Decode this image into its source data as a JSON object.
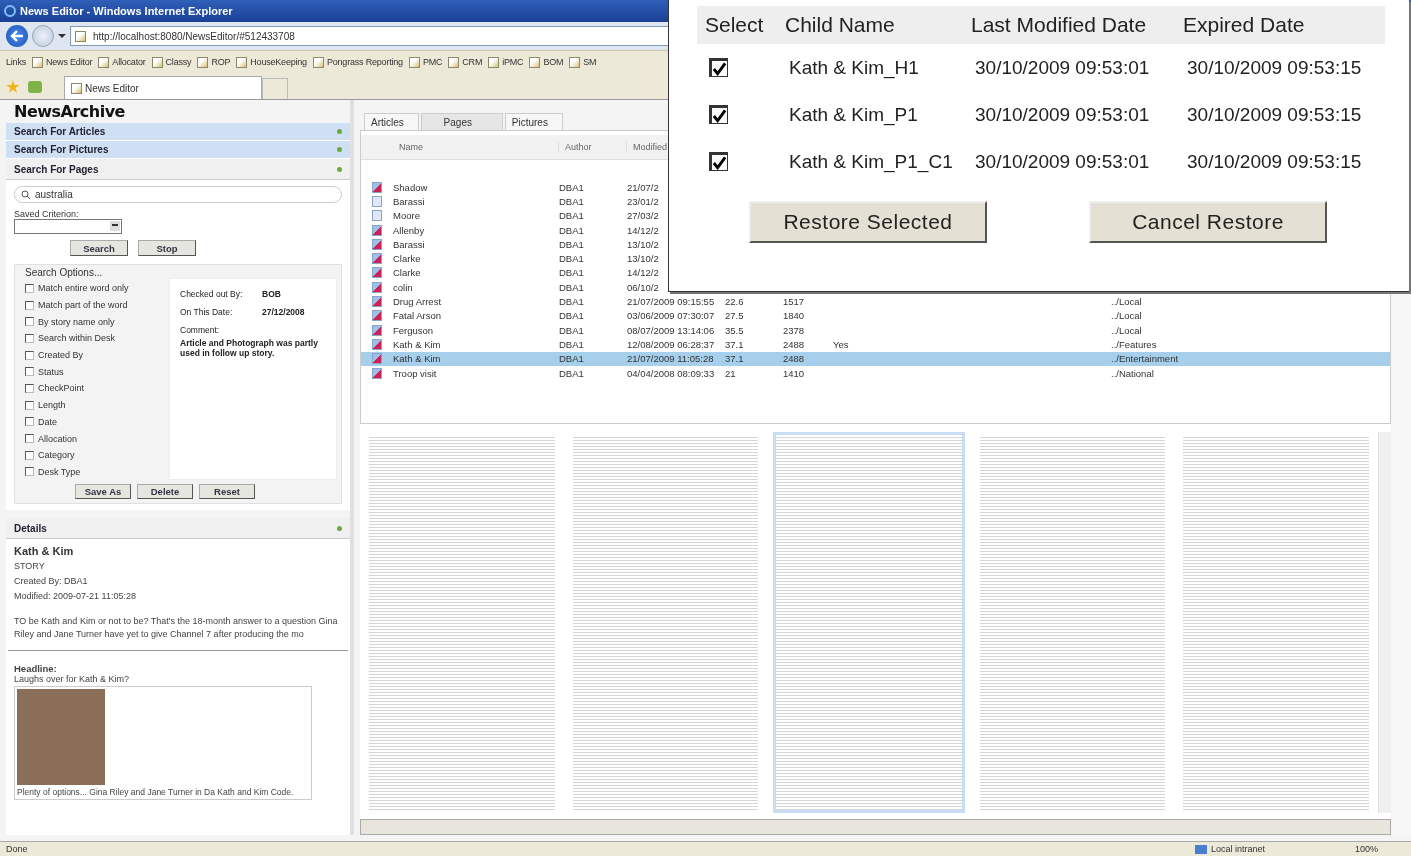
{
  "window": {
    "title": "News Editor - Windows Internet Explorer"
  },
  "address_bar": {
    "url": "http://localhost:8080/NewsEditor/#512433708"
  },
  "links_bar": {
    "label": "Links",
    "items": [
      "News Editor",
      "Allocator",
      "Classy",
      "ROP",
      "HouseKeeping",
      "Pongrass Reporting",
      "PMC",
      "CRM",
      "iPMC",
      "BOM",
      "SM"
    ]
  },
  "browser_tabs": [
    {
      "label": "News Editor",
      "selected": true
    }
  ],
  "app_title": "NewsArchive",
  "search_sections": [
    {
      "label": "Search For Articles",
      "expanded": false
    },
    {
      "label": "Search For Pictures",
      "expanded": false
    },
    {
      "label": "Search For Pages",
      "expanded": true
    }
  ],
  "search": {
    "value": "australia",
    "saved_criterion_label": "Saved Criterion:",
    "buttons": [
      "Search",
      "Stop"
    ]
  },
  "search_options": {
    "label": "Search Options...",
    "options": [
      {
        "label": "Match entire word only",
        "checked": false
      },
      {
        "label": "Match part of the word",
        "checked": false
      },
      {
        "label": "By story name only",
        "checked": false
      },
      {
        "label": "Search within Desk",
        "checked": false
      },
      {
        "label": "Created By",
        "checked": false
      },
      {
        "label": "Status",
        "checked": false
      },
      {
        "label": "CheckPoint",
        "checked": false
      },
      {
        "label": "Length",
        "checked": false
      },
      {
        "label": "Date",
        "checked": false
      },
      {
        "label": "Allocation",
        "checked": false
      },
      {
        "label": "Category",
        "checked": false
      },
      {
        "label": "Desk Type",
        "checked": false
      }
    ],
    "info": [
      {
        "label": "Checked out By:",
        "value": "BOB"
      },
      {
        "label": "On This Date:",
        "value": "27/12/2008"
      }
    ],
    "comment_label": "Comment:",
    "comment": "Article and Photograph was partly used in follow up story.",
    "buttons": [
      "Save As",
      "Delete",
      "Reset"
    ]
  },
  "details": {
    "header": "Details",
    "title": "Kath & Kim",
    "type": "STORY",
    "created_by": "Created By: DBA1",
    "modified": "Modified: 2009-07-21 11:05:28",
    "summary": "TO be Kath and Kim or not to be? That's the 18-month answer to a question Gina Riley and Jane Turner have yet to give Channel 7 after producing the mo",
    "headline_label": "Headline:",
    "headline": "Laughs over for Kath & Kim?",
    "caption": "Plenty of options... Gina Riley and Jane Turner in Da Kath and Kim Code."
  },
  "content_tabs": [
    {
      "label": "Articles",
      "selected": false
    },
    {
      "label": "Pages",
      "selected": true
    },
    {
      "label": "Pictures",
      "selected": false
    }
  ],
  "table": {
    "columns": [
      "Name",
      "Author",
      "Modified"
    ],
    "rows": [
      {
        "kind": "picture",
        "cells": [
          "Shadow",
          "DBA1",
          "21/07/2"
        ],
        "selected": false
      },
      {
        "kind": "plain",
        "cells": [
          "Barassi",
          "DBA1",
          "23/01/2"
        ],
        "selected": false
      },
      {
        "kind": "plain",
        "cells": [
          "Moore",
          "DBA1",
          "27/03/2"
        ],
        "selected": false
      },
      {
        "kind": "picture",
        "cells": [
          "Allenby",
          "DBA1",
          "14/12/2"
        ],
        "selected": false
      },
      {
        "kind": "picture",
        "cells": [
          "Barassi",
          "DBA1",
          "13/10/2"
        ],
        "selected": false
      },
      {
        "kind": "picture",
        "cells": [
          "Clarke",
          "DBA1",
          "13/10/2"
        ],
        "selected": false
      },
      {
        "kind": "picture",
        "cells": [
          "Clarke",
          "DBA1",
          "14/12/2"
        ],
        "selected": false
      },
      {
        "kind": "picture",
        "cells": [
          "colin",
          "DBA1",
          "06/10/2"
        ],
        "selected": false
      },
      {
        "kind": "picture",
        "cells": [
          "Drug Arrest",
          "DBA1",
          "21/07/2009 09:15:55",
          "22.6",
          "1517",
          "",
          "../Local"
        ],
        "selected": false
      },
      {
        "kind": "picture",
        "cells": [
          "Fatal Arson",
          "DBA1",
          "03/06/2009 07:30:07",
          "27.5",
          "1840",
          "",
          "../Local"
        ],
        "selected": false
      },
      {
        "kind": "picture",
        "cells": [
          "Ferguson",
          "DBA1",
          "08/07/2009 13:14:06",
          "35.5",
          "2378",
          "",
          "../Local"
        ],
        "selected": false
      },
      {
        "kind": "picture",
        "cells": [
          "Kath & Kim",
          "DBA1",
          "12/08/2009 06:28:37",
          "37.1",
          "2488",
          "Yes",
          "../Features"
        ],
        "selected": false
      },
      {
        "kind": "picture",
        "cells": [
          "Kath & Kim",
          "DBA1",
          "21/07/2009 11:05:28",
          "37.1",
          "2488",
          "",
          "../Entertainment"
        ],
        "selected": true
      },
      {
        "kind": "picture",
        "cells": [
          "Troop visit",
          "DBA1",
          "04/04/2008 08:09:33",
          "21",
          "1410",
          "",
          "../National"
        ],
        "selected": false
      }
    ]
  },
  "page_thumbnails": [
    {
      "selected": false
    },
    {
      "selected": false
    },
    {
      "selected": true
    },
    {
      "selected": false
    },
    {
      "selected": false
    }
  ],
  "status_bar": {
    "text": "Done",
    "zone": "Local intranet",
    "zoom": "100%"
  },
  "restore_dialog": {
    "columns": [
      "Select",
      "Child Name",
      "Last Modified Date",
      "Expired Date"
    ],
    "rows": [
      {
        "checked": true,
        "name": "Kath & Kim_H1",
        "modified": "30/10/2009 09:53:01",
        "expired": "30/10/2009 09:53:15"
      },
      {
        "checked": true,
        "name": "Kath & Kim_P1",
        "modified": "30/10/2009 09:53:01",
        "expired": "30/10/2009 09:53:15"
      },
      {
        "checked": true,
        "name": "Kath & Kim_P1_C1",
        "modified": "30/10/2009 09:53:01",
        "expired": "30/10/2009 09:53:15"
      }
    ],
    "buttons": [
      "Restore Selected",
      "Cancel Restore"
    ]
  }
}
